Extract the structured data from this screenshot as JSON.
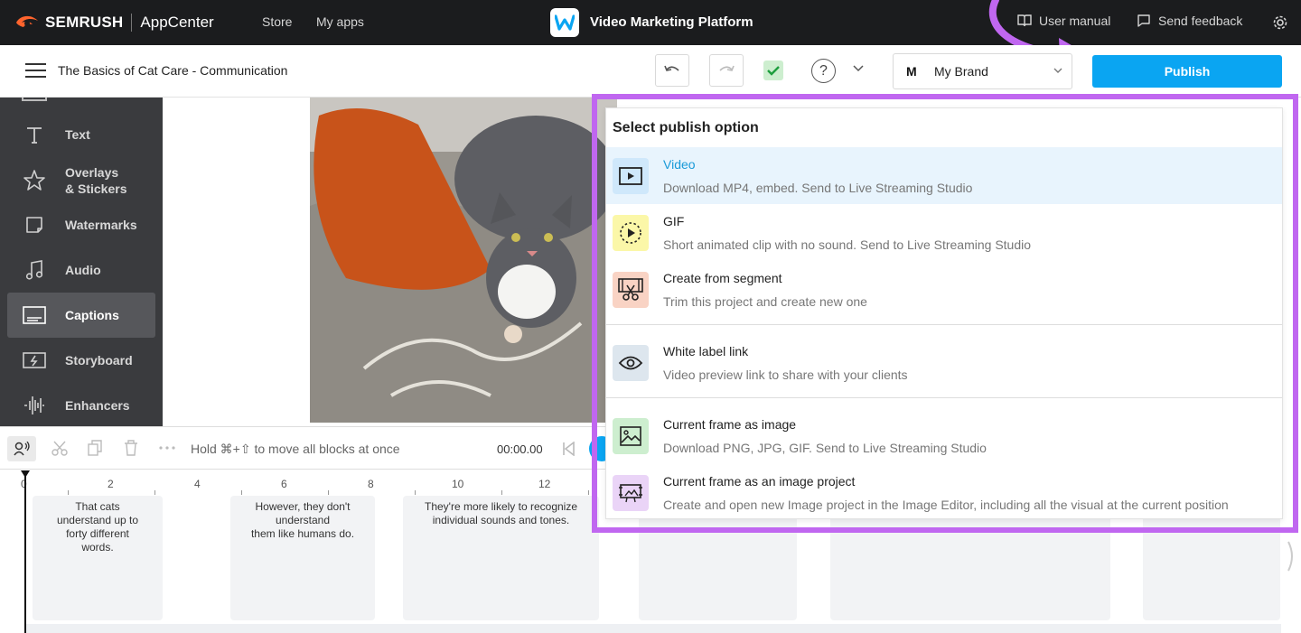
{
  "topbar": {
    "brand": "SEMRUSH",
    "brand_sub": "AppCenter",
    "links": [
      "Store",
      "My apps"
    ],
    "app_title": "Video Marketing Platform",
    "user_manual": "User manual",
    "send_feedback": "Send feedback"
  },
  "toolbar": {
    "project_title": "The Basics of Cat Care - Communication",
    "help": "?",
    "brand_initial": "M",
    "brand_name": "My Brand",
    "publish_label": "Publish"
  },
  "sidebar": {
    "items": [
      {
        "label": "Text",
        "icon": "text-icon"
      },
      {
        "label": "Overlays\n& Stickers",
        "icon": "star-icon"
      },
      {
        "label": "Watermarks",
        "icon": "watermark-icon"
      },
      {
        "label": "Audio",
        "icon": "music-note-icon"
      },
      {
        "label": "Captions",
        "icon": "captions-icon",
        "active": true
      },
      {
        "label": "Storyboard",
        "icon": "storyboard-icon"
      },
      {
        "label": "Enhancers",
        "icon": "waveform-icon"
      }
    ]
  },
  "timeline": {
    "hint": "Hold ⌘+⇧ to move all blocks at once",
    "time": "00:00.00",
    "ruler_labels": [
      "0",
      "2",
      "4",
      "6",
      "8",
      "10",
      "12"
    ],
    "captions": [
      "That cats\nunderstand up to\nforty different\nwords.",
      "However, they don't\nunderstand\nthem like humans do.",
      "They're more likely to recognize\nindividual sounds and tones."
    ]
  },
  "publish_menu": {
    "title": "Select publish option",
    "options": [
      {
        "title": "Video",
        "desc": "Download MP4, embed. Send to Live Streaming Studio",
        "icon": "play-video-icon",
        "color": "#cfe8fb",
        "selected": true
      },
      {
        "title": "GIF",
        "desc": "Short animated clip with no sound. Send to Live Streaming Studio",
        "icon": "gif-icon",
        "color": "#fbf7a8"
      },
      {
        "title": "Create from segment",
        "desc": "Trim this project and create new one",
        "icon": "scissors-film-icon",
        "color": "#f9d3c4"
      },
      {
        "title": "White label link",
        "desc": "Video preview link to share with your clients",
        "icon": "eye-icon",
        "color": "#dde6ee"
      },
      {
        "title": "Current frame as image",
        "desc": "Download PNG, JPG, GIF. Send to Live Streaming Studio",
        "icon": "image-icon",
        "color": "#cdeecf"
      },
      {
        "title": "Current frame as an image project",
        "desc": "Create and open new Image project in the Image Editor, including all the visual at the current position",
        "icon": "image-project-icon",
        "color": "#ead4f7"
      }
    ]
  },
  "colors": {
    "accent": "#0aa5f2",
    "highlight": "#c067f0",
    "topbar": "#1b1c1e",
    "sidebar": "#3a3b3e"
  }
}
